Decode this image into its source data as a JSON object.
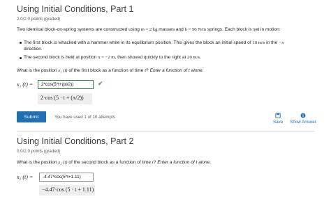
{
  "part1": {
    "title": "Using Initial Conditions, Part 1",
    "points": "2.0/2.0 points (graded)",
    "intro_prefix": "Two identical block-on-spring systems are constructed using",
    "intro_m": "m = 2 kg",
    "intro_mid": "masses and",
    "intro_k": "k = 50 N/m",
    "intro_suffix": "springs. Each block is set in motion:",
    "bullet1_a": "The first block is whacked with a hammer while in its equilibrium position. This gives the block an initial speed of",
    "bullet1_v": "10 m/s",
    "bullet1_b": "in the",
    "bullet1_dir": "−x",
    "bullet1_c": "direction.",
    "bullet2_a": "The second block is held at position",
    "bullet2_x": "x = −2 m",
    "bullet2_b": ", then shoved quickly to the right at",
    "bullet2_v": "20 m/s",
    "bullet2_c": ".",
    "question_a": "What is the position",
    "question_var": "x₁ (t)",
    "question_b": "of the first block as a function of time",
    "question_t": "t",
    "question_c": "?",
    "question_emph": "Enter a function of t alone.",
    "label": "x₁ (t) =",
    "input_value": "2*cos(5*t+(pi/2))",
    "preview": "2·cos (5 · t + (π/2))",
    "check_glyph": "✔",
    "submit_label": "Submit",
    "attempts": "You have used 1 of 10 attempts",
    "save_label": "Save",
    "show_answer_label": "Show Answer"
  },
  "part2": {
    "title": "Using Initial Conditions, Part 2",
    "points": "0.0/2.0 points (graded)",
    "question_a": "What is the position",
    "question_var": "x₂ (t)",
    "question_b": "of the second block as a function of time",
    "question_t": "t",
    "question_c": "?",
    "question_emph": "Enter a function of t alone.",
    "label": "x₂ (t) =",
    "input_value": "-4.47*cos(5*t+1.11)",
    "preview": "−4.47·cos (5 · t + 1.11)"
  },
  "colors": {
    "accent": "#1f6fb2",
    "correct": "#2e8b3a"
  },
  "icons": {
    "save": "floppy-disk-icon",
    "show_answer": "info-icon",
    "correct": "checkmark-icon"
  }
}
